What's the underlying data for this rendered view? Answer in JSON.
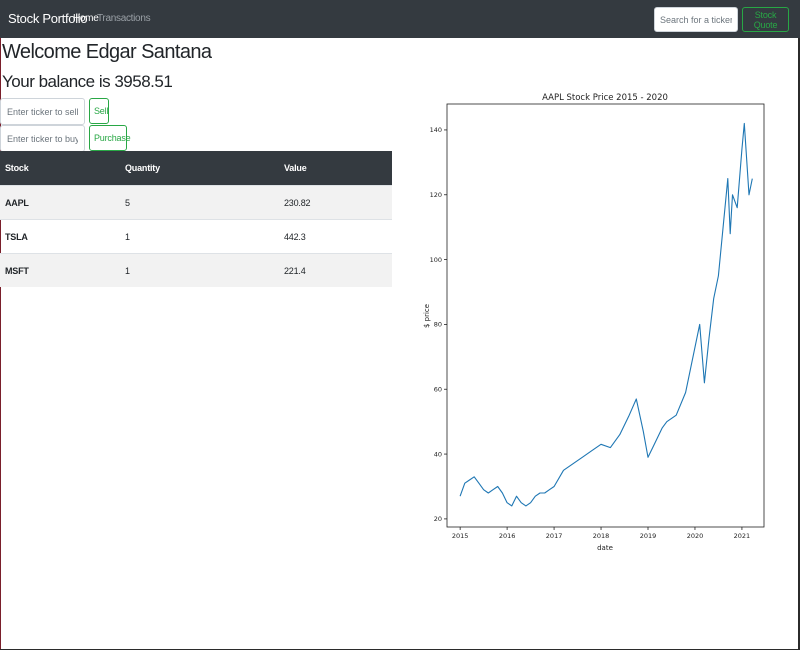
{
  "navbar": {
    "brand": "Stock Portfolio",
    "links": [
      {
        "label": "Home",
        "active": true
      },
      {
        "label": "Transactions",
        "active": false
      }
    ],
    "search": {
      "placeholder": "Search for a ticker"
    },
    "quote_button": "Stock Quote"
  },
  "main": {
    "welcome": "Welcome Edgar Santana",
    "balance": "Your balance is 3958.51",
    "sell_form": {
      "placeholder": "Enter ticker to sell",
      "button": "Sell"
    },
    "buy_form": {
      "placeholder": "Enter ticker to buy",
      "button": "Purchase"
    },
    "table": {
      "headers": [
        "Stock",
        "Quantity",
        "Value"
      ],
      "rows": [
        [
          "AAPL",
          "5",
          "230.82"
        ],
        [
          "TSLA",
          "1",
          "442.3"
        ],
        [
          "MSFT",
          "1",
          "221.4"
        ]
      ]
    }
  },
  "colors": {
    "navbar": "#343a40",
    "accent_green": "#28a745",
    "line": "#1f77b4",
    "table_stripe": "#f2f2f2"
  },
  "chart_data": {
    "type": "line",
    "title": "AAPL Stock Price 2015  - 2020",
    "xlabel": "date",
    "ylabel": "$ price",
    "xlim": [
      2014.72,
      2021.47
    ],
    "ylim": [
      17.5,
      148
    ],
    "x_ticks": [
      2015,
      2016,
      2017,
      2018,
      2019,
      2020,
      2021
    ],
    "y_ticks": [
      20,
      40,
      60,
      80,
      100,
      120,
      140
    ],
    "grid": false,
    "series": [
      {
        "x": [
          2015.0,
          2015.1,
          2015.2,
          2015.3,
          2015.4,
          2015.5,
          2015.6,
          2015.7,
          2015.8,
          2015.9,
          2016.0,
          2016.1,
          2016.2,
          2016.3,
          2016.4,
          2016.5,
          2016.6,
          2016.7,
          2016.8,
          2016.9,
          2017.0,
          2017.2,
          2017.4,
          2017.6,
          2017.8,
          2018.0,
          2018.2,
          2018.4,
          2018.6,
          2018.75,
          2018.9,
          2019.0,
          2019.1,
          2019.3,
          2019.4,
          2019.6,
          2019.8,
          2020.0,
          2020.1,
          2020.2,
          2020.3,
          2020.4,
          2020.5,
          2020.6,
          2020.7,
          2020.75,
          2020.8,
          2020.9,
          2021.0,
          2021.05,
          2021.15,
          2021.22
        ],
        "y": [
          27,
          31,
          32,
          33,
          31,
          29,
          28,
          29,
          30,
          28,
          25,
          24,
          27,
          25,
          24,
          25,
          27,
          28,
          28,
          29,
          30,
          35,
          37,
          39,
          41,
          43,
          42,
          46,
          52,
          57,
          47,
          39,
          42,
          48,
          50,
          52,
          59,
          73,
          80,
          62,
          76,
          88,
          95,
          110,
          125,
          108,
          120,
          116,
          134,
          142,
          120,
          125
        ]
      }
    ]
  }
}
